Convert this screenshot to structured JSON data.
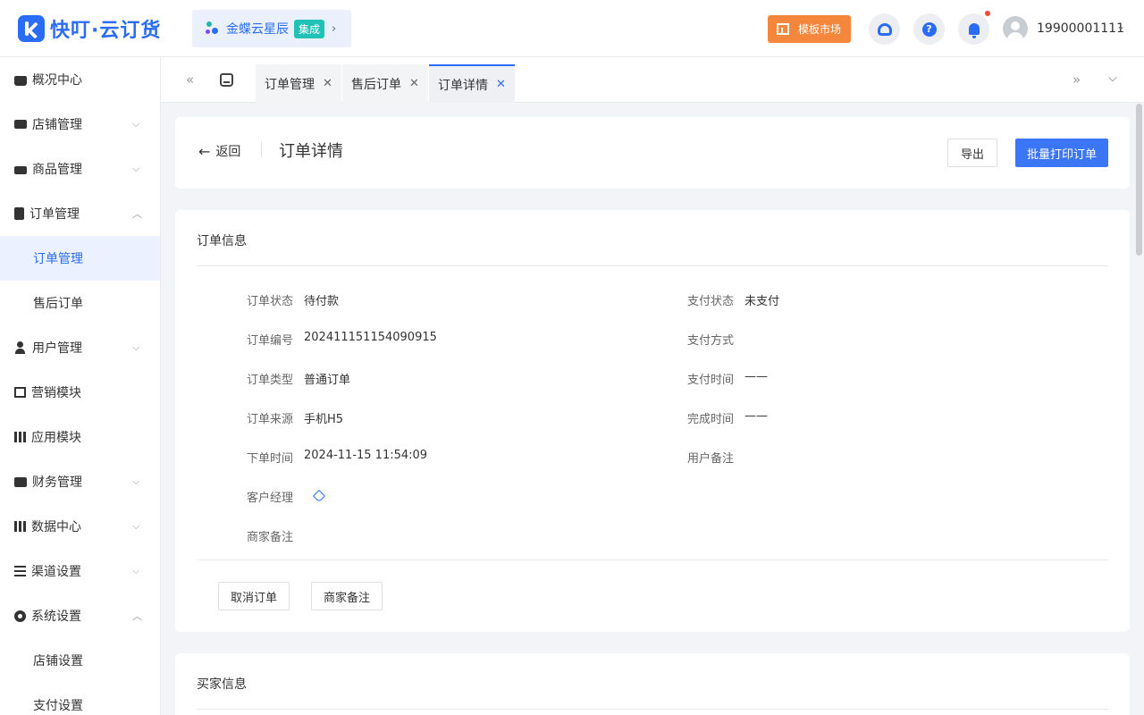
{
  "header": {
    "logo_text": "快叮·云订货",
    "kingdee_label": "金蝶云星辰",
    "kingdee_badge": "集成",
    "kingdee_arrow": "›",
    "template_market": "模板市场",
    "user_phone": "19900001111",
    "icons": [
      "customer-service-icon",
      "help-icon",
      "bell-icon"
    ],
    "accent_color": "#2b6cf6",
    "template_color": "#f5873d"
  },
  "sidebar": {
    "items": [
      {
        "label": "概况中心",
        "icon": "bag-icon",
        "expandable": false
      },
      {
        "label": "店铺管理",
        "icon": "shop-icon",
        "expandable": true
      },
      {
        "label": "商品管理",
        "icon": "box-icon",
        "expandable": true
      },
      {
        "label": "订单管理",
        "icon": "clipboard-icon",
        "expandable": true,
        "expanded": true,
        "children": [
          {
            "label": "订单管理",
            "active": true
          },
          {
            "label": "售后订单"
          }
        ]
      },
      {
        "label": "用户管理",
        "icon": "user-icon",
        "expandable": true
      },
      {
        "label": "营销模块",
        "icon": "trend-icon",
        "expandable": false
      },
      {
        "label": "应用模块",
        "icon": "grid-icon",
        "expandable": false
      },
      {
        "label": "财务管理",
        "icon": "wallet-icon",
        "expandable": true
      },
      {
        "label": "数据中心",
        "icon": "bar-chart-icon",
        "expandable": true
      },
      {
        "label": "渠道设置",
        "icon": "list-icon",
        "expandable": true
      },
      {
        "label": "系统设置",
        "icon": "gear-icon",
        "expandable": true,
        "expanded": true,
        "children": [
          {
            "label": "店铺设置"
          },
          {
            "label": "支付设置"
          }
        ]
      }
    ]
  },
  "tabs": [
    {
      "label": "订单管理"
    },
    {
      "label": "售后订单"
    },
    {
      "label": "订单详情",
      "active": true
    }
  ],
  "page": {
    "back_label": "返回",
    "title": "订单详情",
    "export_label": "导出",
    "print_label": "批量打印订单"
  },
  "order_info": {
    "title": "订单信息",
    "left": [
      {
        "label": "订单状态",
        "value": "待付款"
      },
      {
        "label": "订单编号",
        "value": "202411151154090915"
      },
      {
        "label": "订单类型",
        "value": "普通订单"
      },
      {
        "label": "订单来源",
        "value": "手机H5"
      },
      {
        "label": "下单时间",
        "value": "2024-11-15 11:54:09"
      },
      {
        "label": "客户经理",
        "value": ""
      },
      {
        "label": "商家备注",
        "value": ""
      }
    ],
    "right": [
      {
        "label": "支付状态",
        "value": "未支付"
      },
      {
        "label": "支付方式",
        "value": ""
      },
      {
        "label": "支付时间",
        "value": "——"
      },
      {
        "label": "完成时间",
        "value": "——"
      },
      {
        "label": "用户备注",
        "value": ""
      }
    ],
    "cancel_label": "取消订单",
    "note_label": "商家备注"
  },
  "buyer_info": {
    "title": "买家信息"
  }
}
